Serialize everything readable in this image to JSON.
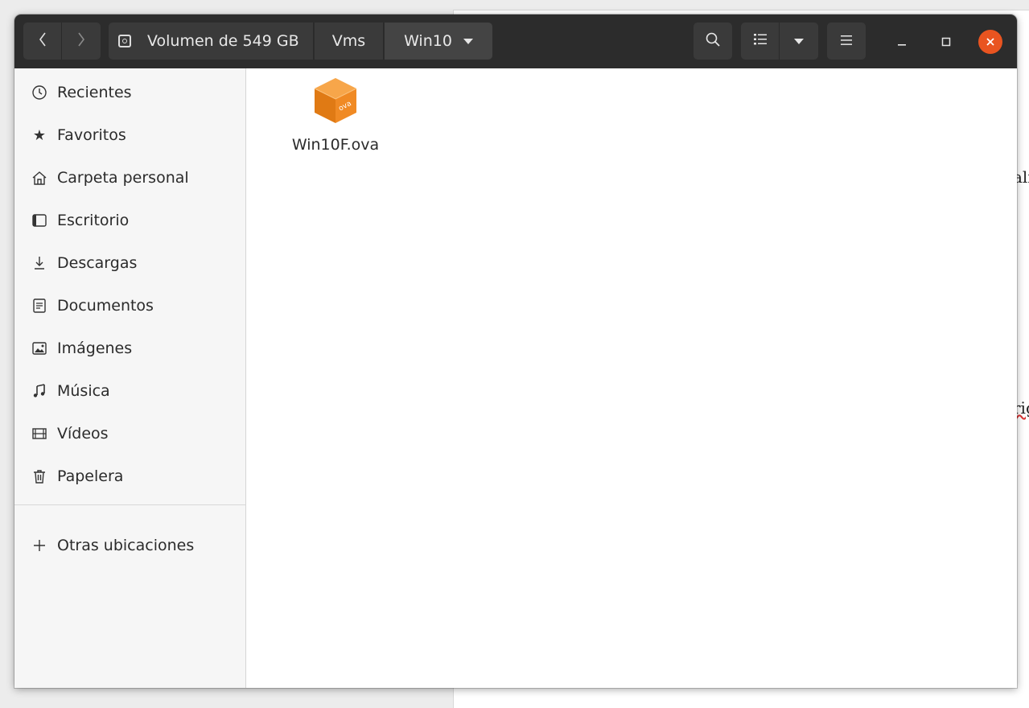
{
  "background_doc": {
    "fragment_1": "ali",
    "fragment_2": "rig"
  },
  "headerbar": {
    "back_icon": "chevron-left-icon",
    "forward_icon": "chevron-right-icon",
    "breadcrumbs": [
      {
        "label": "Volumen de 549 GB",
        "icon": "drive-icon"
      },
      {
        "label": "Vms"
      },
      {
        "label": "Win10"
      }
    ],
    "search_icon": "search-icon",
    "view_icon": "list-view-icon",
    "view_dropdown_icon": "chevron-down-icon",
    "menu_icon": "hamburger-icon"
  },
  "window_controls": {
    "close_color": "#e95420"
  },
  "sidebar": {
    "items": [
      {
        "label": "Recientes",
        "icon": "recent-icon"
      },
      {
        "label": "Favoritos",
        "icon": "star-icon"
      },
      {
        "label": "Carpeta personal",
        "icon": "home-icon"
      },
      {
        "label": "Escritorio",
        "icon": "desktop-icon"
      },
      {
        "label": "Descargas",
        "icon": "download-icon"
      },
      {
        "label": "Documentos",
        "icon": "document-icon"
      },
      {
        "label": "Imágenes",
        "icon": "image-icon"
      },
      {
        "label": "Música",
        "icon": "music-icon"
      },
      {
        "label": "Vídeos",
        "icon": "video-icon"
      },
      {
        "label": "Papelera",
        "icon": "trash-icon"
      }
    ],
    "other": {
      "label": "Otras ubicaciones",
      "icon": "plus-icon"
    }
  },
  "content": {
    "files": [
      {
        "name": "Win10F.ova",
        "icon_label": "ova",
        "icon": "ova-package-icon"
      }
    ]
  },
  "colors": {
    "headerbar": "#2c2c2c",
    "accent": "#e95420",
    "ova_orange": "#f08a24"
  }
}
